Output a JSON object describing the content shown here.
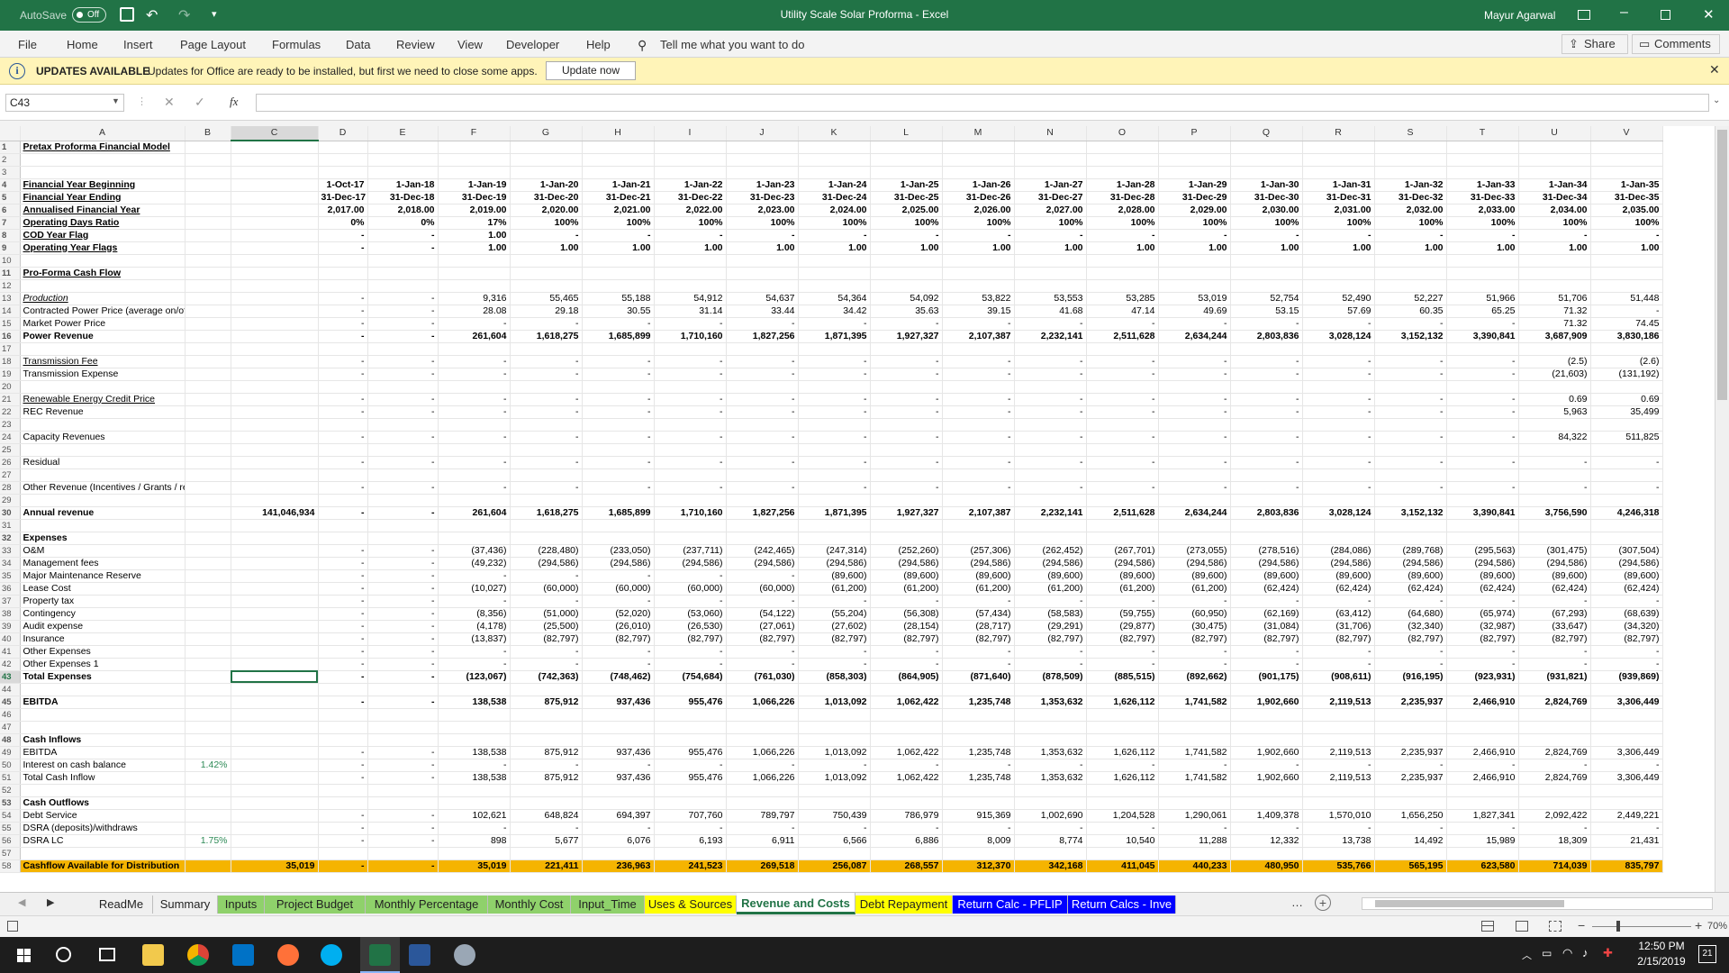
{
  "titlebar": {
    "autosave": "AutoSave",
    "autosave_state": "Off",
    "doc_title": "Utility Scale Solar Proforma  -  Excel",
    "user": "Mayur Agarwal"
  },
  "ribbon": {
    "tabs": [
      "File",
      "Home",
      "Insert",
      "Page Layout",
      "Formulas",
      "Data",
      "Review",
      "View",
      "Developer",
      "Help"
    ],
    "tell_me": "Tell me what you want to do",
    "share": "Share",
    "comments": "Comments"
  },
  "message": {
    "title": "UPDATES AVAILABLE",
    "text": "Updates for Office are ready to be installed, but first we need to close some apps.",
    "button": "Update now"
  },
  "formula_bar": {
    "name_box": "C43",
    "fx": "fx",
    "value": ""
  },
  "columns": [
    "",
    "A",
    "B",
    "C",
    "D",
    "E",
    "F",
    "G",
    "H",
    "I",
    "J",
    "K",
    "L",
    "M",
    "N",
    "O",
    "P",
    "Q",
    "R",
    "S",
    "T",
    "U",
    "V"
  ],
  "rows": [
    {
      "n": "1",
      "c": [
        "Pretax Proforma Financial Model"
      ],
      "s": "bold ul"
    },
    {
      "n": "2",
      "c": []
    },
    {
      "n": "3",
      "c": []
    },
    {
      "n": "4",
      "c": [
        "Financial Year Beginning",
        "",
        "",
        "1-Oct-17",
        "1-Jan-18",
        "1-Jan-19",
        "1-Jan-20",
        "1-Jan-21",
        "1-Jan-22",
        "1-Jan-23",
        "1-Jan-24",
        "1-Jan-25",
        "1-Jan-26",
        "1-Jan-27",
        "1-Jan-28",
        "1-Jan-29",
        "1-Jan-30",
        "1-Jan-31",
        "1-Jan-32",
        "1-Jan-33",
        "1-Jan-34",
        "1-Jan-35"
      ],
      "s": "bold ul"
    },
    {
      "n": "5",
      "c": [
        "Financial Year Ending",
        "",
        "",
        "31-Dec-17",
        "31-Dec-18",
        "31-Dec-19",
        "31-Dec-20",
        "31-Dec-21",
        "31-Dec-22",
        "31-Dec-23",
        "31-Dec-24",
        "31-Dec-25",
        "31-Dec-26",
        "31-Dec-27",
        "31-Dec-28",
        "31-Dec-29",
        "31-Dec-30",
        "31-Dec-31",
        "31-Dec-32",
        "31-Dec-33",
        "31-Dec-34",
        "31-Dec-35"
      ],
      "s": "bold ul"
    },
    {
      "n": "6",
      "c": [
        "Annualised Financial Year",
        "",
        "",
        "2,017.00",
        "2,018.00",
        "2,019.00",
        "2,020.00",
        "2,021.00",
        "2,022.00",
        "2,023.00",
        "2,024.00",
        "2,025.00",
        "2,026.00",
        "2,027.00",
        "2,028.00",
        "2,029.00",
        "2,030.00",
        "2,031.00",
        "2,032.00",
        "2,033.00",
        "2,034.00",
        "2,035.00"
      ],
      "s": "bold ul"
    },
    {
      "n": "7",
      "c": [
        "Operating Days Ratio",
        "",
        "",
        "0%",
        "0%",
        "17%",
        "100%",
        "100%",
        "100%",
        "100%",
        "100%",
        "100%",
        "100%",
        "100%",
        "100%",
        "100%",
        "100%",
        "100%",
        "100%",
        "100%",
        "100%",
        "100%"
      ],
      "s": "bold ul"
    },
    {
      "n": "8",
      "c": [
        "COD Year Flag",
        "",
        "",
        "-",
        "-",
        "1.00",
        "-",
        "-",
        "-",
        "-",
        "-",
        "-",
        "-",
        "-",
        "-",
        "-",
        "-",
        "-",
        "-",
        "-",
        "-",
        "-"
      ],
      "s": "bold ul"
    },
    {
      "n": "9",
      "c": [
        "Operating Year Flags",
        "",
        "",
        "-",
        "-",
        "1.00",
        "1.00",
        "1.00",
        "1.00",
        "1.00",
        "1.00",
        "1.00",
        "1.00",
        "1.00",
        "1.00",
        "1.00",
        "1.00",
        "1.00",
        "1.00",
        "1.00",
        "1.00",
        "1.00"
      ],
      "s": "bold ul"
    },
    {
      "n": "10",
      "c": []
    },
    {
      "n": "11",
      "c": [
        "Pro-Forma Cash Flow"
      ],
      "s": "bold ul"
    },
    {
      "n": "12",
      "c": []
    },
    {
      "n": "13",
      "c": [
        "Production",
        "",
        "",
        "-",
        "-",
        "9,316",
        "55,465",
        "55,188",
        "54,912",
        "54,637",
        "54,364",
        "54,092",
        "53,822",
        "53,553",
        "53,285",
        "53,019",
        "52,754",
        "52,490",
        "52,227",
        "51,966",
        "51,706",
        "51,448"
      ],
      "s": "ital ul"
    },
    {
      "n": "14",
      "c": [
        "Contracted Power Price (average on/off peak)",
        "",
        "",
        "-",
        "-",
        "28.08",
        "29.18",
        "30.55",
        "31.14",
        "33.44",
        "34.42",
        "35.63",
        "39.15",
        "41.68",
        "47.14",
        "49.69",
        "53.15",
        "57.69",
        "60.35",
        "65.25",
        "71.32",
        "-"
      ]
    },
    {
      "n": "15",
      "c": [
        "Market Power Price",
        "",
        "",
        "-",
        "-",
        "-",
        "-",
        "-",
        "-",
        "-",
        "-",
        "-",
        "-",
        "-",
        "-",
        "-",
        "-",
        "-",
        "-",
        "-",
        "71.32",
        "74.45"
      ]
    },
    {
      "n": "16",
      "c": [
        "Power Revenue",
        "",
        "",
        "-",
        "-",
        "261,604",
        "1,618,275",
        "1,685,899",
        "1,710,160",
        "1,827,256",
        "1,871,395",
        "1,927,327",
        "2,107,387",
        "2,232,141",
        "2,511,628",
        "2,634,244",
        "2,803,836",
        "3,028,124",
        "3,152,132",
        "3,390,841",
        "3,687,909",
        "3,830,186"
      ],
      "s": "bold"
    },
    {
      "n": "17",
      "c": []
    },
    {
      "n": "18",
      "c": [
        "Transmission Fee",
        "",
        "",
        "-",
        "-",
        "-",
        "-",
        "-",
        "-",
        "-",
        "-",
        "-",
        "-",
        "-",
        "-",
        "-",
        "-",
        "-",
        "-",
        "-",
        "(2.5)",
        "(2.6)"
      ],
      "s": "ul"
    },
    {
      "n": "19",
      "c": [
        "Transmission Expense",
        "",
        "",
        "-",
        "-",
        "-",
        "-",
        "-",
        "-",
        "-",
        "-",
        "-",
        "-",
        "-",
        "-",
        "-",
        "-",
        "-",
        "-",
        "-",
        "(21,603)",
        "(131,192)"
      ]
    },
    {
      "n": "20",
      "c": []
    },
    {
      "n": "21",
      "c": [
        "Renewable Energy Credit Price",
        "",
        "",
        "-",
        "-",
        "-",
        "-",
        "-",
        "-",
        "-",
        "-",
        "-",
        "-",
        "-",
        "-",
        "-",
        "-",
        "-",
        "-",
        "-",
        "0.69",
        "0.69"
      ],
      "s": "ul"
    },
    {
      "n": "22",
      "c": [
        "REC Revenue",
        "",
        "",
        "-",
        "-",
        "-",
        "-",
        "-",
        "-",
        "-",
        "-",
        "-",
        "-",
        "-",
        "-",
        "-",
        "-",
        "-",
        "-",
        "-",
        "5,963",
        "35,499"
      ]
    },
    {
      "n": "23",
      "c": []
    },
    {
      "n": "24",
      "c": [
        "Capacity Revenues",
        "",
        "",
        "-",
        "-",
        "-",
        "-",
        "-",
        "-",
        "-",
        "-",
        "-",
        "-",
        "-",
        "-",
        "-",
        "-",
        "-",
        "-",
        "-",
        "84,322",
        "511,825"
      ]
    },
    {
      "n": "25",
      "c": []
    },
    {
      "n": "26",
      "c": [
        "Residual",
        "",
        "",
        "-",
        "-",
        "-",
        "-",
        "-",
        "-",
        "-",
        "-",
        "-",
        "-",
        "-",
        "-",
        "-",
        "-",
        "-",
        "-",
        "-",
        "-",
        "-"
      ]
    },
    {
      "n": "27",
      "c": []
    },
    {
      "n": "28",
      "c": [
        "Other Revenue (Incentives / Grants / refunds Etc)",
        "",
        "",
        "-",
        "-",
        "-",
        "-",
        "-",
        "-",
        "-",
        "-",
        "-",
        "-",
        "-",
        "-",
        "-",
        "-",
        "-",
        "-",
        "-",
        "-",
        "-"
      ]
    },
    {
      "n": "29",
      "c": []
    },
    {
      "n": "30",
      "c": [
        "Annual revenue",
        "",
        "141,046,934",
        "-",
        "-",
        "261,604",
        "1,618,275",
        "1,685,899",
        "1,710,160",
        "1,827,256",
        "1,871,395",
        "1,927,327",
        "2,107,387",
        "2,232,141",
        "2,511,628",
        "2,634,244",
        "2,803,836",
        "3,028,124",
        "3,152,132",
        "3,390,841",
        "3,756,590",
        "4,246,318"
      ],
      "s": "bold"
    },
    {
      "n": "31",
      "c": []
    },
    {
      "n": "32",
      "c": [
        "Expenses"
      ],
      "s": "bold"
    },
    {
      "n": "33",
      "c": [
        "O&M",
        "",
        "",
        "-",
        "-",
        "(37,436)",
        "(228,480)",
        "(233,050)",
        "(237,711)",
        "(242,465)",
        "(247,314)",
        "(252,260)",
        "(257,306)",
        "(262,452)",
        "(267,701)",
        "(273,055)",
        "(278,516)",
        "(284,086)",
        "(289,768)",
        "(295,563)",
        "(301,475)",
        "(307,504)"
      ]
    },
    {
      "n": "34",
      "c": [
        "Management fees",
        "",
        "",
        "-",
        "-",
        "(49,232)",
        "(294,586)",
        "(294,586)",
        "(294,586)",
        "(294,586)",
        "(294,586)",
        "(294,586)",
        "(294,586)",
        "(294,586)",
        "(294,586)",
        "(294,586)",
        "(294,586)",
        "(294,586)",
        "(294,586)",
        "(294,586)",
        "(294,586)",
        "(294,586)"
      ]
    },
    {
      "n": "35",
      "c": [
        "Major Maintenance Reserve",
        "",
        "",
        "-",
        "-",
        "-",
        "-",
        "-",
        "-",
        "-",
        "(89,600)",
        "(89,600)",
        "(89,600)",
        "(89,600)",
        "(89,600)",
        "(89,600)",
        "(89,600)",
        "(89,600)",
        "(89,600)",
        "(89,600)",
        "(89,600)",
        "(89,600)"
      ]
    },
    {
      "n": "36",
      "c": [
        "Lease Cost",
        "",
        "",
        "-",
        "-",
        "(10,027)",
        "(60,000)",
        "(60,000)",
        "(60,000)",
        "(60,000)",
        "(61,200)",
        "(61,200)",
        "(61,200)",
        "(61,200)",
        "(61,200)",
        "(61,200)",
        "(62,424)",
        "(62,424)",
        "(62,424)",
        "(62,424)",
        "(62,424)",
        "(62,424)"
      ]
    },
    {
      "n": "37",
      "c": [
        "Property tax",
        "",
        "",
        "-",
        "-",
        "-",
        "-",
        "-",
        "-",
        "-",
        "-",
        "-",
        "-",
        "-",
        "-",
        "-",
        "-",
        "-",
        "-",
        "-",
        "-",
        "-"
      ]
    },
    {
      "n": "38",
      "c": [
        "Contingency",
        "",
        "",
        "-",
        "-",
        "(8,356)",
        "(51,000)",
        "(52,020)",
        "(53,060)",
        "(54,122)",
        "(55,204)",
        "(56,308)",
        "(57,434)",
        "(58,583)",
        "(59,755)",
        "(60,950)",
        "(62,169)",
        "(63,412)",
        "(64,680)",
        "(65,974)",
        "(67,293)",
        "(68,639)"
      ]
    },
    {
      "n": "39",
      "c": [
        "Audit expense",
        "",
        "",
        "-",
        "-",
        "(4,178)",
        "(25,500)",
        "(26,010)",
        "(26,530)",
        "(27,061)",
        "(27,602)",
        "(28,154)",
        "(28,717)",
        "(29,291)",
        "(29,877)",
        "(30,475)",
        "(31,084)",
        "(31,706)",
        "(32,340)",
        "(32,987)",
        "(33,647)",
        "(34,320)"
      ]
    },
    {
      "n": "40",
      "c": [
        "Insurance",
        "",
        "",
        "-",
        "-",
        "(13,837)",
        "(82,797)",
        "(82,797)",
        "(82,797)",
        "(82,797)",
        "(82,797)",
        "(82,797)",
        "(82,797)",
        "(82,797)",
        "(82,797)",
        "(82,797)",
        "(82,797)",
        "(82,797)",
        "(82,797)",
        "(82,797)",
        "(82,797)",
        "(82,797)"
      ]
    },
    {
      "n": "41",
      "c": [
        "  Other Expenses",
        "",
        "",
        "-",
        "-",
        "-",
        "-",
        "-",
        "-",
        "-",
        "-",
        "-",
        "-",
        "-",
        "-",
        "-",
        "-",
        "-",
        "-",
        "-",
        "-",
        "-"
      ]
    },
    {
      "n": "42",
      "c": [
        "  Other Expenses 1",
        "",
        "",
        "-",
        "-",
        "-",
        "-",
        "-",
        "-",
        "-",
        "-",
        "-",
        "-",
        "-",
        "-",
        "-",
        "-",
        "-",
        "-",
        "-",
        "-",
        "-"
      ]
    },
    {
      "n": "43",
      "c": [
        "Total Expenses",
        "",
        "",
        "-",
        "-",
        "(123,067)",
        "(742,363)",
        "(748,462)",
        "(754,684)",
        "(761,030)",
        "(858,303)",
        "(864,905)",
        "(871,640)",
        "(878,509)",
        "(885,515)",
        "(892,662)",
        "(901,175)",
        "(908,611)",
        "(916,195)",
        "(923,931)",
        "(931,821)",
        "(939,869)"
      ],
      "s": "bold sel"
    },
    {
      "n": "44",
      "c": []
    },
    {
      "n": "45",
      "c": [
        "EBITDA",
        "",
        "",
        "-",
        "-",
        "138,538",
        "875,912",
        "937,436",
        "955,476",
        "1,066,226",
        "1,013,092",
        "1,062,422",
        "1,235,748",
        "1,353,632",
        "1,626,112",
        "1,741,582",
        "1,902,660",
        "2,119,513",
        "2,235,937",
        "2,466,910",
        "2,824,769",
        "3,306,449"
      ],
      "s": "bold"
    },
    {
      "n": "46",
      "c": []
    },
    {
      "n": "47",
      "c": []
    },
    {
      "n": "48",
      "c": [
        "Cash Inflows"
      ],
      "s": "bold"
    },
    {
      "n": "49",
      "c": [
        "EBITDA",
        "",
        "",
        "-",
        "-",
        "138,538",
        "875,912",
        "937,436",
        "955,476",
        "1,066,226",
        "1,013,092",
        "1,062,422",
        "1,235,748",
        "1,353,632",
        "1,626,112",
        "1,741,582",
        "1,902,660",
        "2,119,513",
        "2,235,937",
        "2,466,910",
        "2,824,769",
        "3,306,449"
      ]
    },
    {
      "n": "50",
      "c": [
        "Interest on cash balance",
        "1.42%",
        "",
        "-",
        "-",
        "-",
        "-",
        "-",
        "-",
        "-",
        "-",
        "-",
        "-",
        "-",
        "-",
        "-",
        "-",
        "-",
        "-",
        "-",
        "-",
        "-"
      ]
    },
    {
      "n": "51",
      "c": [
        "Total Cash Inflow",
        "",
        "",
        "-",
        "-",
        "138,538",
        "875,912",
        "937,436",
        "955,476",
        "1,066,226",
        "1,013,092",
        "1,062,422",
        "1,235,748",
        "1,353,632",
        "1,626,112",
        "1,741,582",
        "1,902,660",
        "2,119,513",
        "2,235,937",
        "2,466,910",
        "2,824,769",
        "3,306,449"
      ]
    },
    {
      "n": "52",
      "c": []
    },
    {
      "n": "53",
      "c": [
        "Cash Outflows"
      ],
      "s": "bold"
    },
    {
      "n": "54",
      "c": [
        "Debt Service",
        "",
        "",
        "-",
        "-",
        "102,621",
        "648,824",
        "694,397",
        "707,760",
        "789,797",
        "750,439",
        "786,979",
        "915,369",
        "1,002,690",
        "1,204,528",
        "1,290,061",
        "1,409,378",
        "1,570,010",
        "1,656,250",
        "1,827,341",
        "2,092,422",
        "2,449,221"
      ]
    },
    {
      "n": "55",
      "c": [
        "DSRA (deposits)/withdraws",
        "",
        "",
        "-",
        "-",
        "-",
        "-",
        "-",
        "-",
        "-",
        "-",
        "-",
        "-",
        "-",
        "-",
        "-",
        "-",
        "-",
        "-",
        "-",
        "-",
        "-"
      ]
    },
    {
      "n": "56",
      "c": [
        "DSRA LC",
        "1.75%",
        "",
        "-",
        "-",
        "898",
        "5,677",
        "6,076",
        "6,193",
        "6,911",
        "6,566",
        "6,886",
        "8,009",
        "8,774",
        "10,540",
        "11,288",
        "12,332",
        "13,738",
        "14,492",
        "15,989",
        "18,309",
        "21,431"
      ]
    },
    {
      "n": "57",
      "c": []
    },
    {
      "n": "58",
      "c": [
        "Cashflow Available for Distribution",
        "",
        "35,019",
        "-",
        "-",
        "35,019",
        "221,411",
        "236,963",
        "241,523",
        "269,518",
        "256,087",
        "268,557",
        "312,370",
        "342,168",
        "411,045",
        "440,233",
        "480,950",
        "535,766",
        "565,195",
        "623,580",
        "714,039",
        "835,797"
      ],
      "s": "hl"
    }
  ],
  "sheet_tabs": [
    "ReadMe",
    "Summary",
    "Inputs",
    "Project Budget",
    "Monthly Percentage",
    "Monthly Cost",
    "Input_Time",
    "Uses & Sources",
    "Revenue and Costs",
    "Debt Repayment",
    "Return Calc - PFLIP",
    "Return Calcs - Inve"
  ],
  "tab_colors": {
    "Inputs": "#8fd16b",
    "Project Budget": "#8fd16b",
    "Monthly Percentage": "#8fd16b",
    "Monthly Cost": "#8fd16b",
    "Input_Time": "#8fd16b",
    "Uses & Sources": "#ffff00",
    "Revenue and Costs": "#ffffff",
    "Debt Repayment": "#ffff00",
    "Return Calc - PFLIP": "#0000ff",
    "Return Calcs - Inve": "#0000ff"
  },
  "status": {
    "zoom": "70%"
  },
  "clock": {
    "time": "12:50 PM",
    "date": "2/15/2019",
    "notif": "21"
  }
}
